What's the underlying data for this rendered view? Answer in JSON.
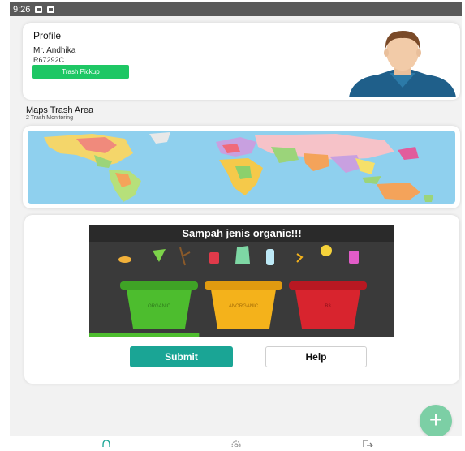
{
  "status_bar": {
    "time": "9:26"
  },
  "profile": {
    "title": "Profile",
    "name": "Mr. Andhika",
    "id": "R67292C",
    "pickup_button": "Trash Pickup"
  },
  "maps": {
    "title": "Maps Trash Area",
    "subtitle": "2 Trash Monitoring"
  },
  "trash_banner": {
    "heading": "Sampah jenis organic!!!",
    "bins": [
      "ORGANIC",
      "ANORGANIC",
      "B3"
    ],
    "bin_colors": [
      "#4dbd2e",
      "#f4b21b",
      "#d8242e"
    ],
    "progress": 0.36
  },
  "actions": {
    "submit_label": "Submit",
    "help_label": "Help"
  },
  "fab": {
    "icon": "plus-icon"
  },
  "bottom_nav": {
    "items": [
      "bell-icon",
      "gear-icon",
      "logout-icon"
    ],
    "active_color": "#1aa595"
  }
}
